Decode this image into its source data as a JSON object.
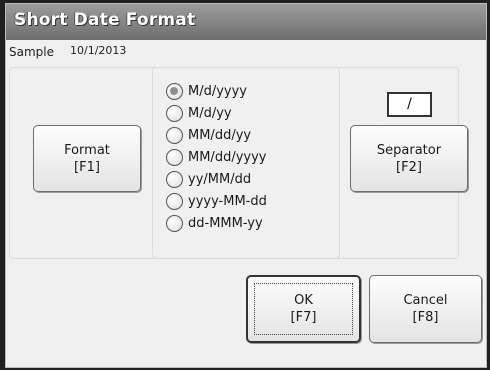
{
  "dialog": {
    "title": "Short Date Format",
    "sample_label": "Sample",
    "sample_value": "10/1/2013"
  },
  "format_button": {
    "line1": "Format",
    "line2": "[F1]"
  },
  "separator_button": {
    "line1": "Separator",
    "line2": "[F2]"
  },
  "separator_value": "/",
  "formats": [
    {
      "label": "M/d/yyyy",
      "selected": true
    },
    {
      "label": "M/d/yy",
      "selected": false
    },
    {
      "label": "MM/dd/yy",
      "selected": false
    },
    {
      "label": "MM/dd/yyyy",
      "selected": false
    },
    {
      "label": "yy/MM/dd",
      "selected": false
    },
    {
      "label": "yyyy-MM-dd",
      "selected": false
    },
    {
      "label": "dd-MMM-yy",
      "selected": false
    }
  ],
  "ok_button": {
    "line1": "OK",
    "line2": "[F7]"
  },
  "cancel_button": {
    "line1": "Cancel",
    "line2": "[F8]"
  }
}
